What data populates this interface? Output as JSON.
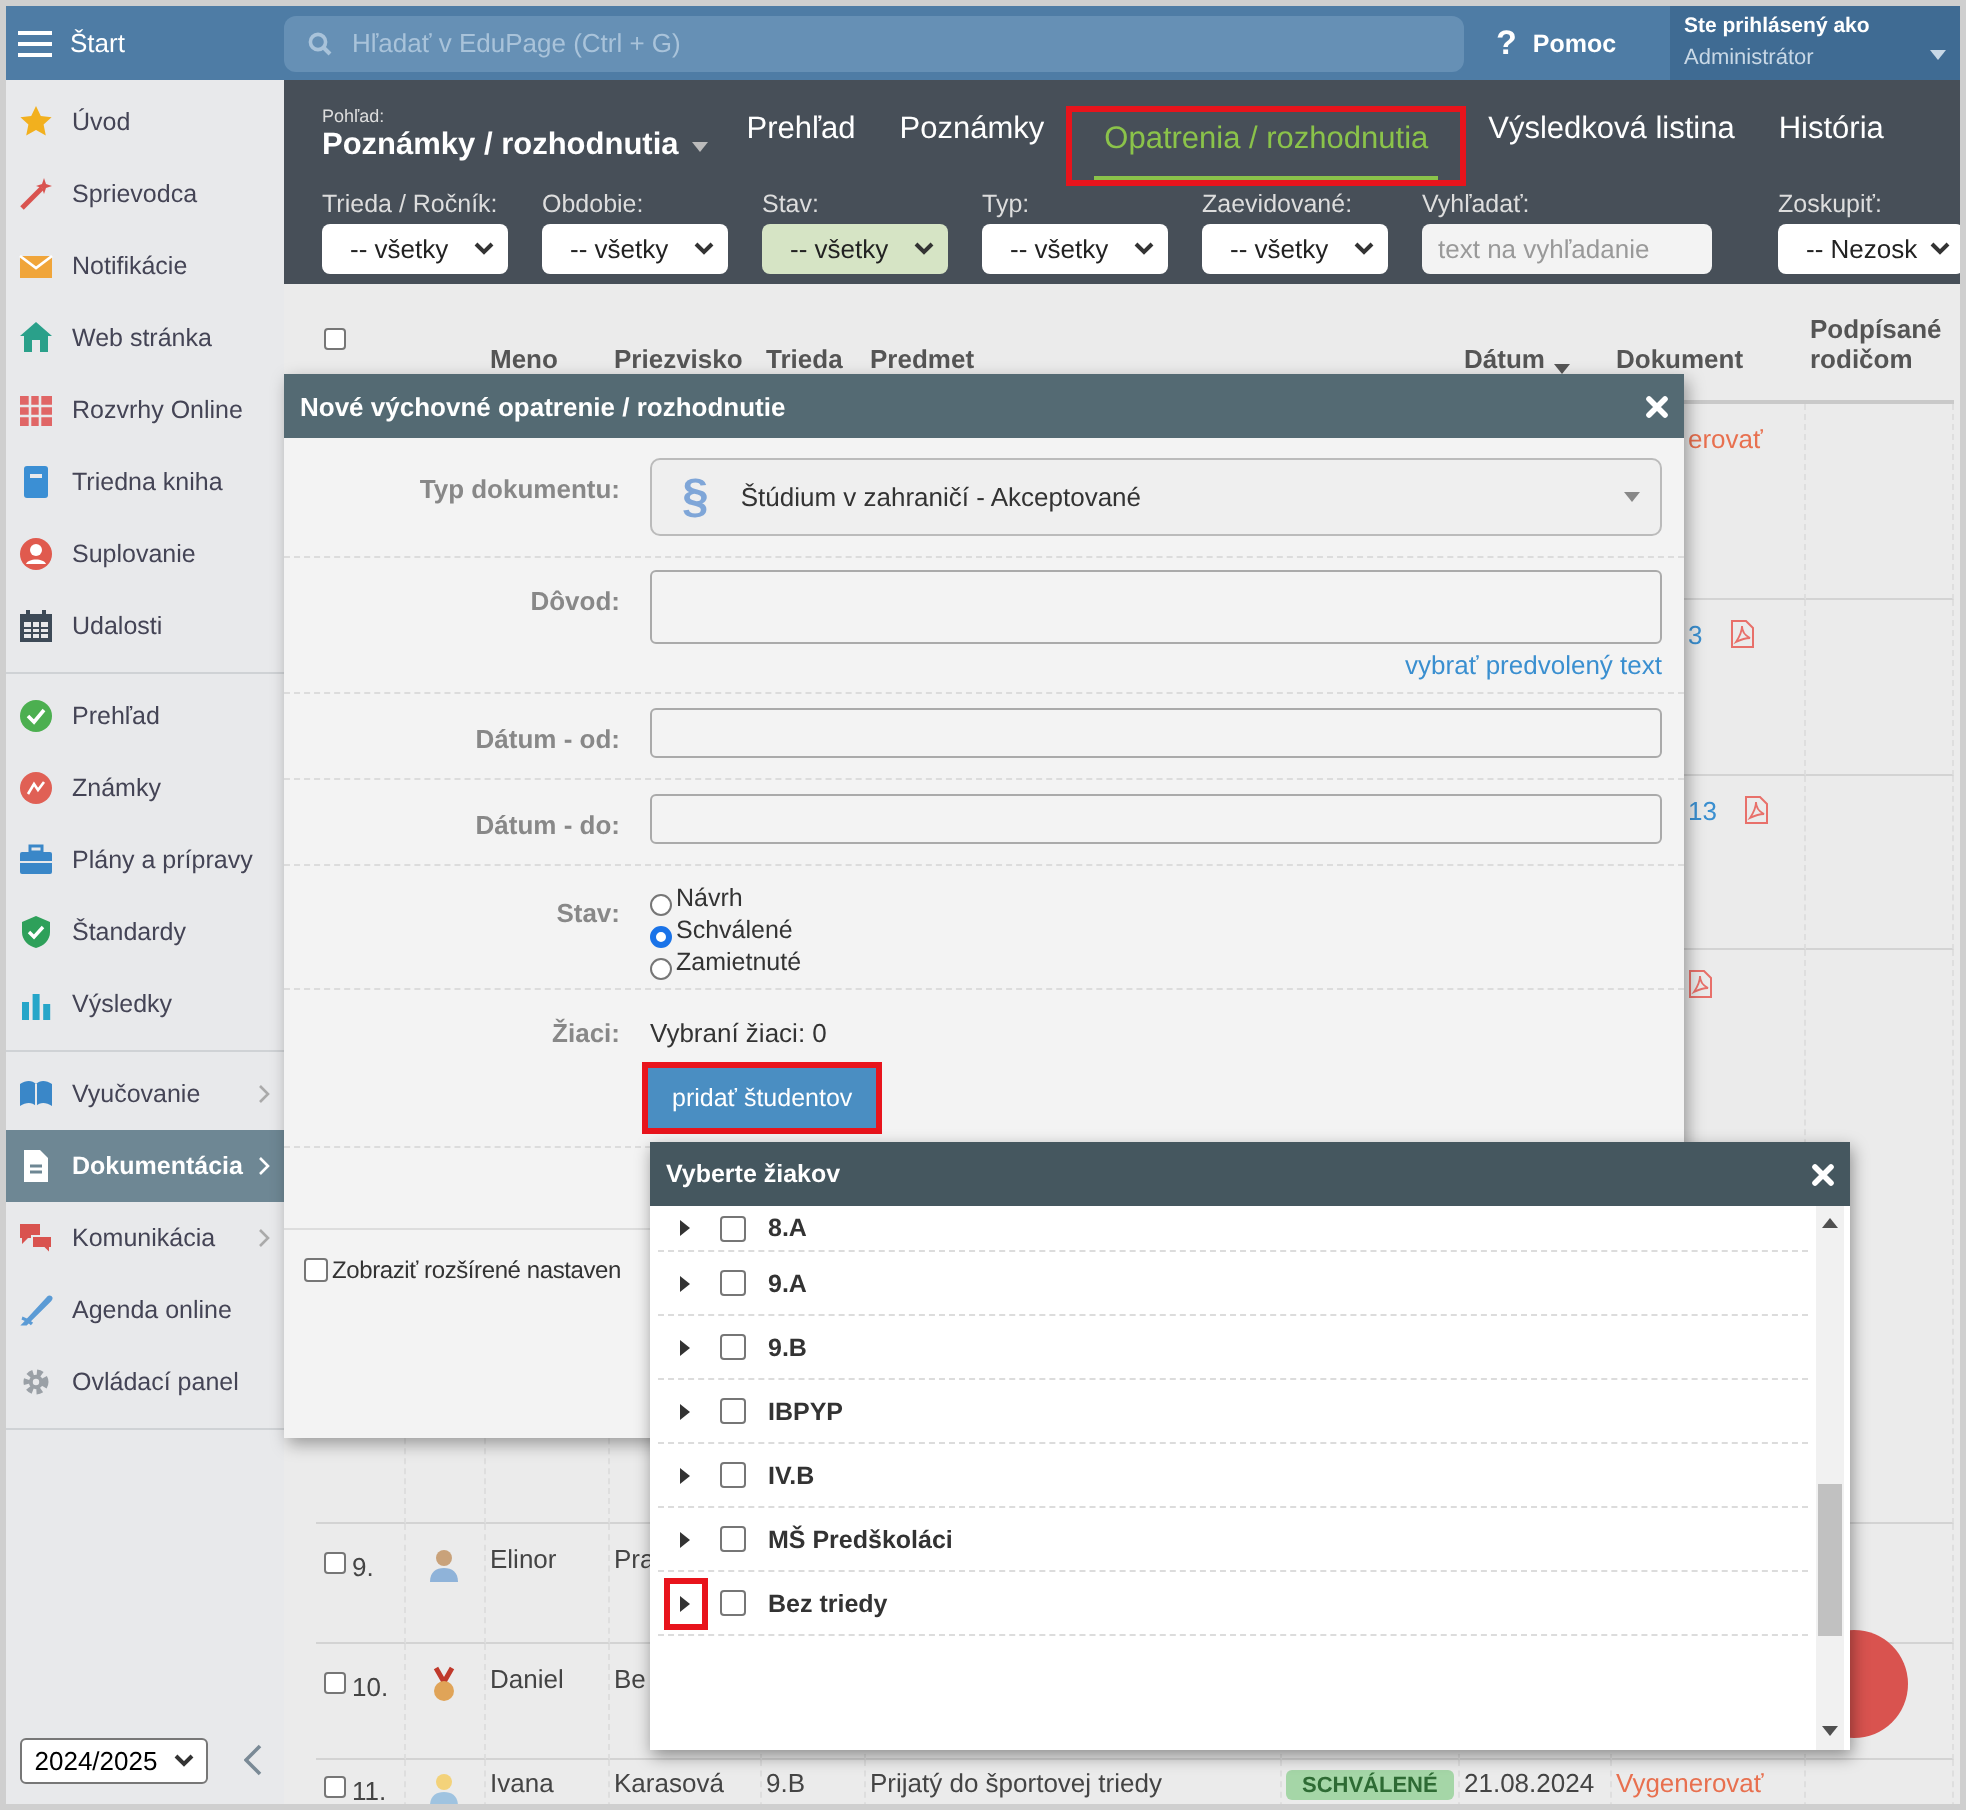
{
  "topbar": {
    "start_label": "Štart",
    "search_placeholder": "Hľadať v EduPage (Ctrl + G)",
    "help_glyph": "?",
    "help_label": "Pomoc",
    "user_caption": "Ste prihlásený ako",
    "user_name": "Administrátor"
  },
  "sidebar": {
    "sections": [
      [
        {
          "label": "Úvod",
          "selected": false,
          "submenu": false
        },
        {
          "label": "Sprievodca",
          "selected": false,
          "submenu": false
        },
        {
          "label": "Notifikácie",
          "selected": false,
          "submenu": false
        },
        {
          "label": "Web stránka",
          "selected": false,
          "submenu": false
        },
        {
          "label": "Rozvrhy Online",
          "selected": false,
          "submenu": false
        },
        {
          "label": "Triedna kniha",
          "selected": false,
          "submenu": false
        },
        {
          "label": "Suplovanie",
          "selected": false,
          "submenu": false
        },
        {
          "label": "Udalosti",
          "selected": false,
          "submenu": false
        }
      ],
      [
        {
          "label": "Prehľad",
          "selected": false,
          "submenu": false
        },
        {
          "label": "Známky",
          "selected": false,
          "submenu": false
        },
        {
          "label": "Plány a prípravy",
          "selected": false,
          "submenu": false
        },
        {
          "label": "Štandardy",
          "selected": false,
          "submenu": false
        },
        {
          "label": "Výsledky",
          "selected": false,
          "submenu": false
        }
      ],
      [
        {
          "label": "Vyučovanie",
          "selected": false,
          "submenu": true
        },
        {
          "label": "Dokumentácia",
          "selected": true,
          "submenu": true
        },
        {
          "label": "Komunikácia",
          "selected": false,
          "submenu": true
        },
        {
          "label": "Agenda online",
          "selected": false,
          "submenu": false
        },
        {
          "label": "Ovládací panel",
          "selected": false,
          "submenu": false
        }
      ]
    ],
    "year": "2024/2025"
  },
  "view": {
    "caption": "Pohľad:",
    "title": "Poznámky / rozhodnutia"
  },
  "tabs": [
    {
      "label": "Prehľad",
      "selected": false,
      "highlighted": false
    },
    {
      "label": "Poznámky",
      "selected": false,
      "highlighted": false
    },
    {
      "label": "Opatrenia / rozhodnutia",
      "selected": true,
      "highlighted": true
    },
    {
      "label": "Výsledková listina",
      "selected": false,
      "highlighted": false
    },
    {
      "label": "História",
      "selected": false,
      "highlighted": false
    }
  ],
  "filters": [
    {
      "kind": "select",
      "label": "Trieda / Ročník:",
      "value": "-- všetky",
      "highlighted": false
    },
    {
      "kind": "select",
      "label": "Obdobie:",
      "value": "-- všetky",
      "highlighted": false
    },
    {
      "kind": "select",
      "label": "Stav:",
      "value": "-- všetky",
      "highlighted": true
    },
    {
      "kind": "select",
      "label": "Typ:",
      "value": "-- všetky",
      "highlighted": false
    },
    {
      "kind": "select",
      "label": "Zaevidované:",
      "value": "-- všetky",
      "highlighted": false
    },
    {
      "kind": "input",
      "label": "Vyhľadať:",
      "placeholder": "text na vyhľadanie"
    },
    {
      "kind": "select",
      "label": "Zoskupiť:",
      "value": "-- Nezosk",
      "highlighted": false
    }
  ],
  "table": {
    "header_checkbox": {
      "checked": false
    },
    "columns": [
      {
        "label": "Meno",
        "sorted": false
      },
      {
        "label": "Priezvisko",
        "sorted": false
      },
      {
        "label": "Trieda",
        "sorted": false
      },
      {
        "label": "Predmet",
        "sorted": false
      },
      {
        "label": "Dátum",
        "sorted": true
      },
      {
        "label": "Dokument",
        "sorted": false
      },
      {
        "label": "Podpísané rodičom",
        "sorted": false
      }
    ],
    "rows": [
      {
        "document": "erovať",
        "link": false
      },
      {
        "document": "3",
        "link": true,
        "pdf": true
      },
      {
        "document": "13",
        "link": true,
        "pdf": true
      },
      {
        "pdf": true
      },
      {
        "checked": false,
        "number": "9.",
        "name": "Elinor",
        "surname": "Pra"
      },
      {
        "checked": false,
        "number": "10.",
        "name": "Daniel",
        "surname": "Be"
      },
      {
        "checked": false,
        "number": "11.",
        "name": "Ivana",
        "surname": "Karasová",
        "class": "9.B",
        "subject": "Prijatý do športovej triedy",
        "status": "SCHVÁLENÉ",
        "date": "21.08.2024",
        "document": "Vygenerovať",
        "link": false
      }
    ]
  },
  "dialog": {
    "title": "Nové výchovné opatrenie / rozhodnutie",
    "fields": [
      {
        "kind": "select",
        "label": "Typ dokumentu:",
        "glyph": "§",
        "value": "Štúdium v zahraničí - Akceptované"
      },
      {
        "kind": "textarea",
        "label": "Dôvod:",
        "link": "vybrať predvolený text"
      },
      {
        "kind": "input",
        "label": "Dátum - od:"
      },
      {
        "kind": "input",
        "label": "Dátum - do:"
      },
      {
        "kind": "radios",
        "label": "Stav:",
        "options": [
          {
            "label": "Návrh",
            "selected": false
          },
          {
            "label": "Schválené",
            "selected": true
          },
          {
            "label": "Zamietnuté",
            "selected": false
          }
        ]
      },
      {
        "kind": "students",
        "label": "Žiaci:",
        "summary": "Vybraní žiaci: 0",
        "button": "pridať študentov",
        "highlighted": true
      }
    ],
    "advanced": {
      "label": "Zobraziť rozšírené nastaven",
      "checked": false
    }
  },
  "picker": {
    "title": "Vyberte žiakov",
    "items": [
      {
        "label": "8.A",
        "checked": false,
        "expanded": false,
        "highlighted": false
      },
      {
        "label": "9.A",
        "checked": false,
        "expanded": false,
        "highlighted": false
      },
      {
        "label": "9.B",
        "checked": false,
        "expanded": false,
        "highlighted": false
      },
      {
        "label": "IBPYP",
        "checked": false,
        "expanded": false,
        "highlighted": false
      },
      {
        "label": "IV.B",
        "checked": false,
        "expanded": false,
        "highlighted": false
      },
      {
        "label": "MŠ Predškoláci",
        "checked": false,
        "expanded": false,
        "highlighted": false
      },
      {
        "label": "Bez triedy",
        "checked": false,
        "expanded": false,
        "highlighted": true
      }
    ]
  }
}
